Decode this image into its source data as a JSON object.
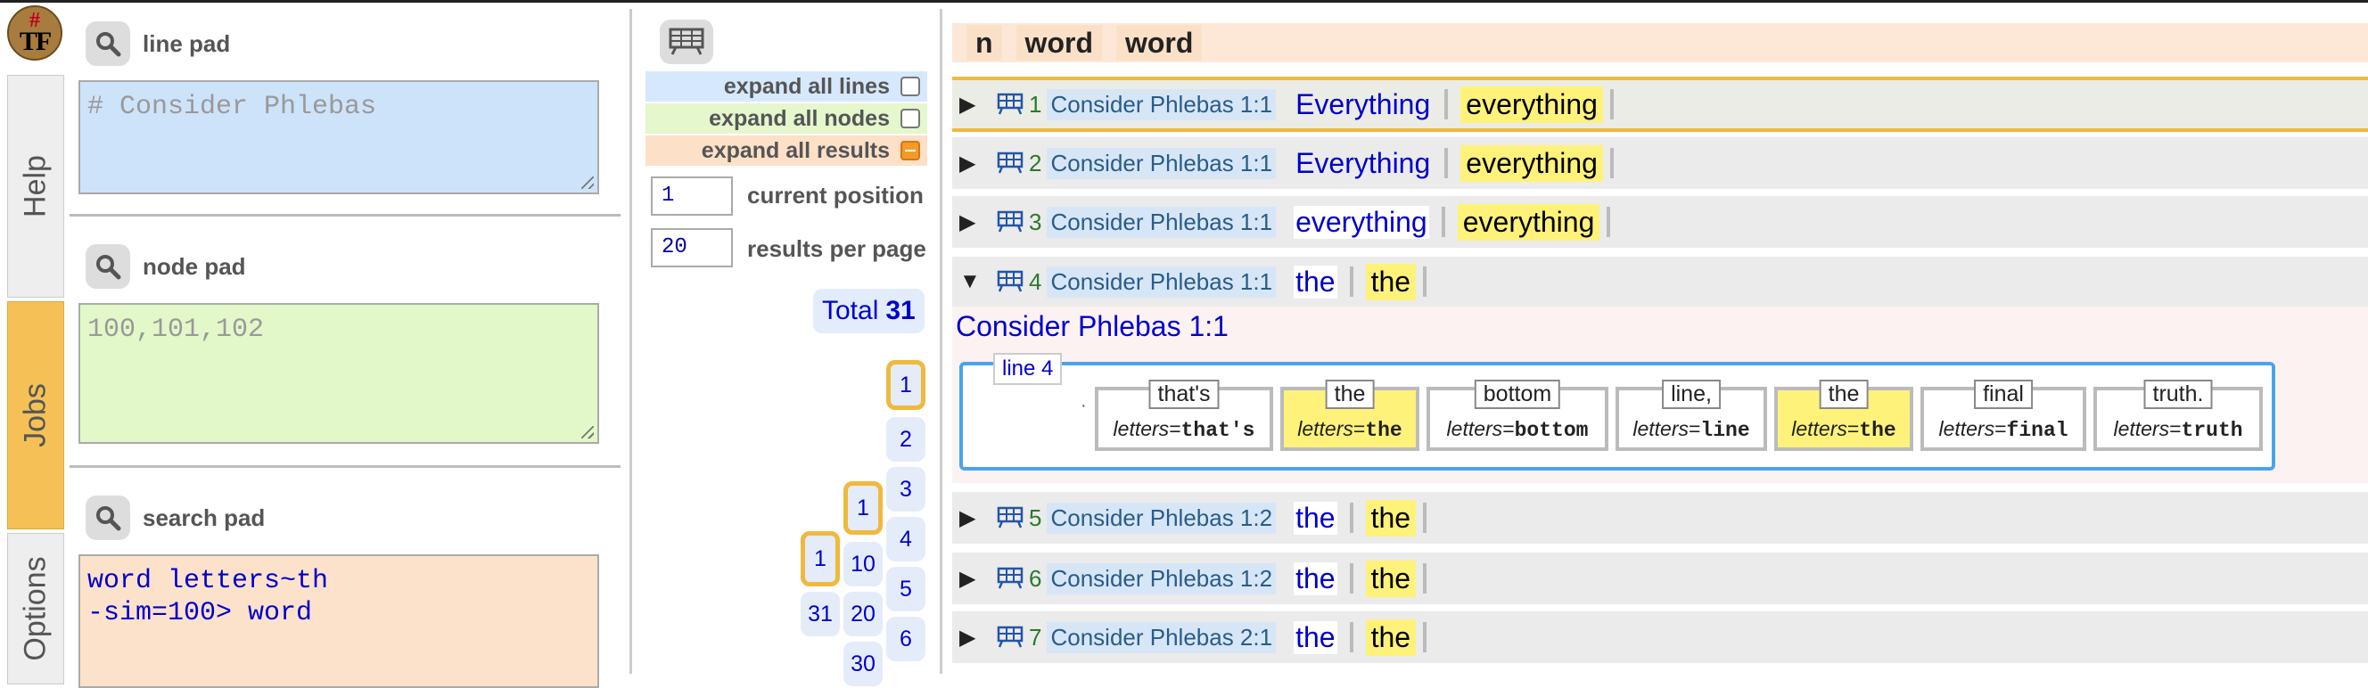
{
  "logo": {
    "hash": "#",
    "text": "TF"
  },
  "sidebar": {
    "tabs": [
      {
        "label": "Help"
      },
      {
        "label": "Jobs"
      },
      {
        "label": "Options"
      }
    ]
  },
  "pads": {
    "line": {
      "label": "line pad",
      "value": "# Consider Phlebas"
    },
    "node": {
      "label": "node pad",
      "value": "100,101,102"
    },
    "search": {
      "label": "search pad",
      "value": "word letters~th\n-sim=100> word"
    }
  },
  "controls": {
    "expand_lines": "expand all lines",
    "expand_nodes": "expand all nodes",
    "expand_results": "expand all results",
    "current_position": {
      "value": "1",
      "label": "current position"
    },
    "results_per_page": {
      "value": "20",
      "label": "results per page"
    },
    "total_label": "Total",
    "total_value": "31"
  },
  "pagination": {
    "col4": [
      "1",
      "2",
      "3",
      "4",
      "5",
      "6"
    ],
    "col3": [
      "1",
      "10",
      "20",
      "30"
    ],
    "col2": [
      "1",
      "31"
    ]
  },
  "table": {
    "headers": [
      "n",
      "word",
      "word"
    ],
    "rows": [
      {
        "n": "1",
        "section": "Consider Phlebas 1:1",
        "w1": "Everything",
        "w2": "everything"
      },
      {
        "n": "2",
        "section": "Consider Phlebas 1:1",
        "w1": "Everything",
        "w2": "everything"
      },
      {
        "n": "3",
        "section": "Consider Phlebas 1:1",
        "w1": "everything",
        "w2": "everything"
      },
      {
        "n": "4",
        "section": "Consider Phlebas 1:1",
        "w1": "the",
        "w2": "the"
      },
      {
        "n": "5",
        "section": "Consider Phlebas 1:2",
        "w1": "the",
        "w2": "the"
      },
      {
        "n": "6",
        "section": "Consider Phlebas 1:2",
        "w1": "the",
        "w2": "the"
      },
      {
        "n": "7",
        "section": "Consider Phlebas 2:1",
        "w1": "the",
        "w2": "the"
      }
    ],
    "expanded": {
      "title": "Consider Phlebas 1:1",
      "line_tag": "line 4",
      "dot": "·",
      "words": [
        {
          "text": "that's",
          "feature": "letters",
          "value": "that's",
          "highlight": false
        },
        {
          "text": "the",
          "feature": "letters",
          "value": "the",
          "highlight": true
        },
        {
          "text": "bottom",
          "feature": "letters",
          "value": "bottom",
          "highlight": false
        },
        {
          "text": "line,",
          "feature": "letters",
          "value": "line",
          "highlight": false
        },
        {
          "text": "the",
          "feature": "letters",
          "value": "the",
          "highlight": true
        },
        {
          "text": "final",
          "feature": "letters",
          "value": "final",
          "highlight": false
        },
        {
          "text": "truth.",
          "feature": "letters",
          "value": "truth",
          "highlight": false
        }
      ]
    }
  },
  "colors": {
    "jobs_tab": "#f5c156",
    "highlight": "#fff27a",
    "link": "#0000cc",
    "line_box": "#4aa3ef"
  }
}
